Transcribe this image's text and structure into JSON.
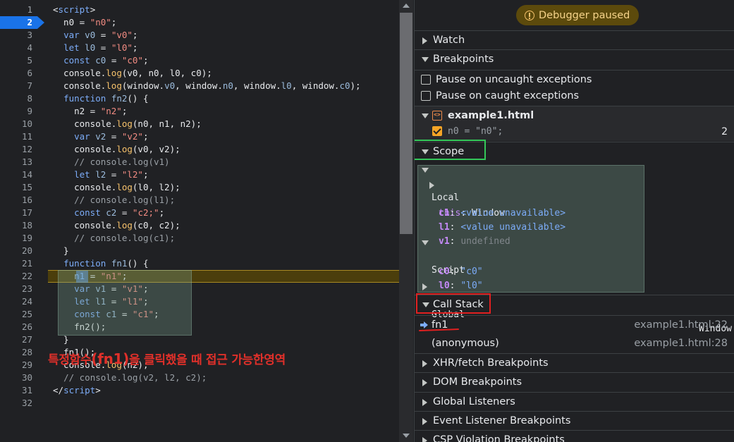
{
  "editor": {
    "lines": [
      {
        "n": "1",
        "html": "&lt;<span class='kw'>script</span>&gt;"
      },
      {
        "n": "2",
        "html": "  n0 = <span class='str'>\"n0\"</span>;",
        "breakpoint": true
      },
      {
        "n": "3",
        "html": "  <span class='kw'>var</span> <span class='var'>v0</span> = <span class='str'>\"v0\"</span>;"
      },
      {
        "n": "4",
        "html": "  <span class='kw'>let</span> <span class='var'>l0</span> = <span class='str'>\"l0\"</span>;"
      },
      {
        "n": "5",
        "html": "  <span class='kw'>const</span> <span class='var'>c0</span> = <span class='str'>\"c0\"</span>;"
      },
      {
        "n": "6",
        "html": "  console.<span class='fn'>log</span>(v0, n0, l0, c0);"
      },
      {
        "n": "7",
        "html": "  console.<span class='fn'>log</span>(window.<span class='var'>v0</span>, window.<span class='var'>n0</span>, window.<span class='var'>l0</span>, window.<span class='var'>c0</span>);"
      },
      {
        "n": "8",
        "html": "  <span class='kw'>function</span> <span class='var'>fn2</span>() {"
      },
      {
        "n": "9",
        "html": "    n2 = <span class='str'>\"n2\"</span>;"
      },
      {
        "n": "10",
        "html": "    console.<span class='fn'>log</span>(n0, n1, n2);"
      },
      {
        "n": "11",
        "html": "    <span class='kw'>var</span> <span class='var'>v2</span> = <span class='str'>\"v2\"</span>;"
      },
      {
        "n": "12",
        "html": "    console.<span class='fn'>log</span>(v0, v2);"
      },
      {
        "n": "13",
        "html": "    <span class='cm'>// console.log(v1)</span>"
      },
      {
        "n": "14",
        "html": "    <span class='kw'>let</span> <span class='var'>l2</span> = <span class='str'>\"l2\"</span>;"
      },
      {
        "n": "15",
        "html": "    console.<span class='fn'>log</span>(l0, l2);"
      },
      {
        "n": "16",
        "html": "    <span class='cm'>// console.log(l1);</span>"
      },
      {
        "n": "17",
        "html": "    <span class='kw'>const</span> <span class='var'>c2</span> = <span class='str'>\"c2;\"</span>;"
      },
      {
        "n": "18",
        "html": "    console.<span class='fn'>log</span>(c0, c2);"
      },
      {
        "n": "19",
        "html": "    <span class='cm'>// console.log(c1);</span>"
      },
      {
        "n": "20",
        "html": "  }"
      },
      {
        "n": "21",
        "html": "  <span class='kw'>function</span> <span class='var'>fn1</span>() {"
      },
      {
        "n": "22",
        "html": "    <span class='var'>n1</span> = <span class='str'>\"n1\"</span>;",
        "exec": true
      },
      {
        "n": "23",
        "html": "    <span class='kw'>var</span> <span class='var'>v1</span> = <span class='str'>\"v1\"</span>;"
      },
      {
        "n": "24",
        "html": "    <span class='kw'>let</span> <span class='var'>l1</span> = <span class='str'>\"l1\"</span>;"
      },
      {
        "n": "25",
        "html": "    <span class='kw'>const</span> <span class='var'>c1</span> = <span class='str'>\"c1\"</span>;"
      },
      {
        "n": "26",
        "html": "    fn2();"
      },
      {
        "n": "27",
        "html": "  }"
      },
      {
        "n": "28",
        "html": "  fn1();"
      },
      {
        "n": "29",
        "html": "  console.<span class='fn'>log</span>(n2);"
      },
      {
        "n": "30",
        "html": "  <span class='cm'>// console.log(v2, l2, c2);</span>"
      },
      {
        "n": "31",
        "html": "&lt;/<span class='kw'>script</span>&gt;"
      },
      {
        "n": "32",
        "html": ""
      }
    ],
    "annotation_pre": "특정함수",
    "annotation_big": "(fn1)",
    "annotation_post": "을 클릭했을 때 접근 가능한영역"
  },
  "debugger": {
    "paused_label": "Debugger paused",
    "watch_label": "Watch",
    "breakpoints_label": "Breakpoints",
    "pause_uncaught_label": "Pause on uncaught exceptions",
    "pause_caught_label": "Pause on caught exceptions",
    "file_icon": "<>",
    "bp_file_name": "example1.html",
    "bp_code": "n0 = \"n0\";",
    "bp_line_number": "2",
    "scope_label": "Scope",
    "scope": {
      "local_label": "Local",
      "this_key": "this",
      "this_val": "Window",
      "c1_key": "c1",
      "l1_key": "l1",
      "v1_key": "v1",
      "unavailable": "<value unavailable>",
      "undefined": "undefined",
      "script_label": "Script",
      "c0_key": "c0",
      "c0_val": "\"c0\"",
      "l0_key": "l0",
      "l0_val": "\"l0\"",
      "global_label": "Global",
      "global_val": "Window",
      "colon": ":"
    },
    "callstack_label": "Call Stack",
    "callstack": [
      {
        "name": "fn1",
        "loc": "example1.html:22",
        "current": true
      },
      {
        "name": "(anonymous)",
        "loc": "example1.html:28",
        "current": false
      }
    ],
    "more_sections": [
      "XHR/fetch Breakpoints",
      "DOM Breakpoints",
      "Global Listeners",
      "Event Listener Breakpoints",
      "CSP Violation Breakpoints"
    ]
  },
  "colors": {
    "accent": "#1a73e8",
    "paused_bg": "#5c4a0c",
    "scope_highlight": "#34c759",
    "callstack_highlight": "#e02020",
    "annotation": "#e0302a"
  }
}
